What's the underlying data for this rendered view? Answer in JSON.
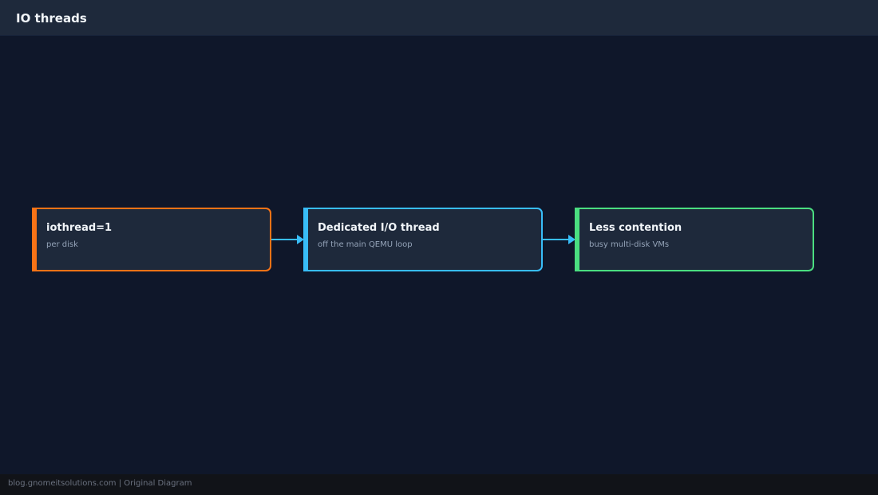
{
  "header": {
    "title": "IO threads"
  },
  "diagram": {
    "nodes": [
      {
        "title": "iothread=1",
        "subtitle": "per disk",
        "color": "#f97316"
      },
      {
        "title": "Dedicated I/O thread",
        "subtitle": "off the main QEMU loop",
        "color": "#38bdf8"
      },
      {
        "title": "Less contention",
        "subtitle": "busy multi-disk VMs",
        "color": "#4ade80"
      }
    ],
    "edge_color": "#38bdf8"
  },
  "footer": {
    "text": "blog.gnomeitsolutions.com | Original Diagram"
  },
  "colors": {
    "background": "#0f172a",
    "header": "#1e293b",
    "node_fill": "#1e293b"
  }
}
